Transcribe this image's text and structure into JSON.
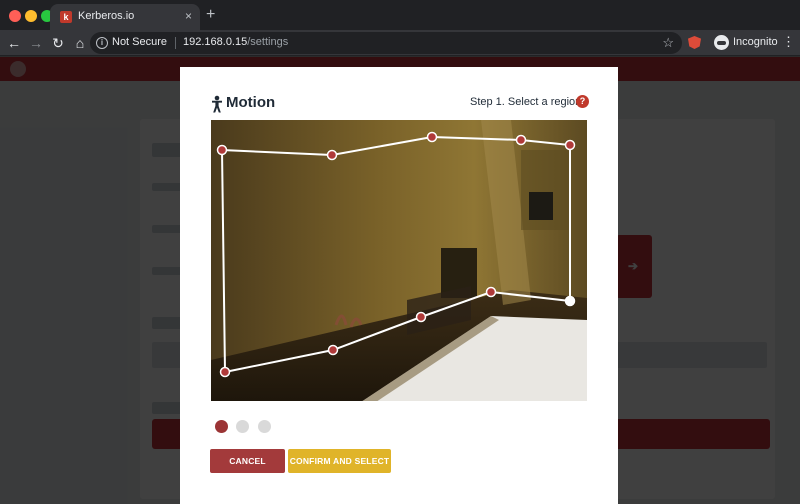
{
  "browser": {
    "tab_title": "Kerberos.io",
    "tab_favicon": "k",
    "tab_close": "×",
    "new_tab": "+",
    "security_label": "Not Secure",
    "url_host": "192.168.0.15",
    "url_path": "/settings",
    "profile_label": "Incognito"
  },
  "icons": {
    "back": "←",
    "forward": "→",
    "reload": "↻",
    "home": "⌂",
    "info": "i",
    "star": "☆",
    "menu": "⋮",
    "help": "?",
    "arrow_right": "➔"
  },
  "modal": {
    "title": "Motion",
    "step_label": "Step 1. Select a region",
    "steps": [
      {
        "state": "active"
      },
      {
        "state": "inactive"
      },
      {
        "state": "inactive"
      }
    ],
    "cancel_label": "CANCEL",
    "confirm_label": "CONFIRM AND SELECT"
  },
  "colors": {
    "accent_red": "#9b3435",
    "confirm_yellow": "#e0b429",
    "brand_red": "#c9353e",
    "inactive_dot": "#d9d9d9"
  }
}
